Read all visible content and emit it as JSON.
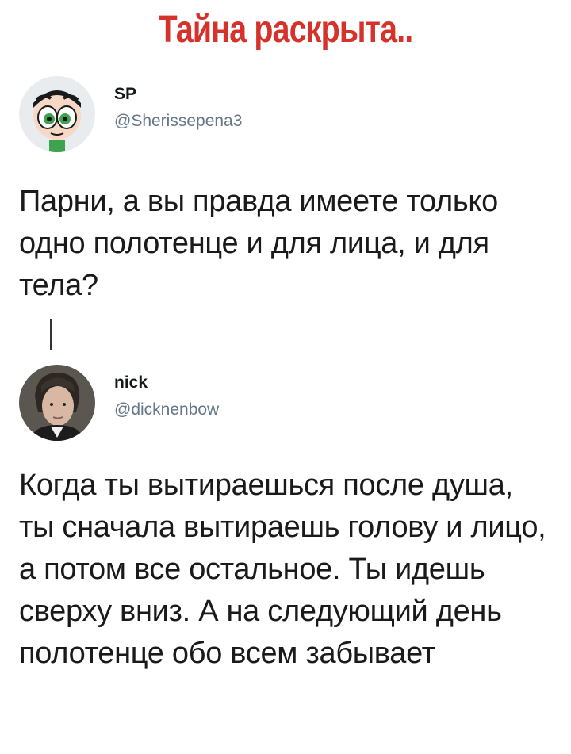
{
  "title": "Тайна раскрыта..",
  "tweets": [
    {
      "display_name": "SP",
      "handle": "@Sherissepena3",
      "text": "Парни, а вы правда имеете только одно полотенце и для лица, и для тела?"
    },
    {
      "display_name": "nick",
      "handle": "@dicknenbow",
      "text": "Когда ты вытираешься после душа, ты сначала вытираешь голову и лицо, а потом все остальное. Ты идешь сверху вниз. А на следующий день полотенце обо всем забывает"
    }
  ],
  "colors": {
    "title": "#d4322b",
    "handle": "#657786",
    "text": "#1a1a1a"
  }
}
